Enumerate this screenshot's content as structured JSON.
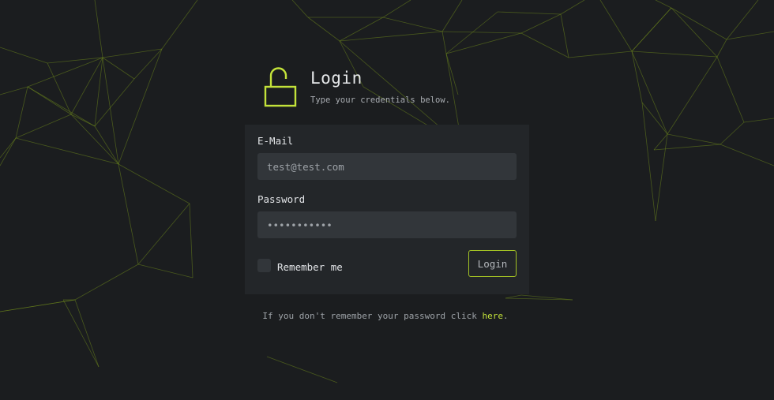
{
  "header": {
    "title": "Login",
    "subtitle": "Type your credentials below.",
    "icon": "unlocked-padlock-icon"
  },
  "form": {
    "email_label": "E-Mail",
    "email_value": "test@test.com",
    "password_label": "Password",
    "password_value": "•••••••••••",
    "remember_label": "Remember me",
    "remember_checked": false,
    "submit_label": "Login"
  },
  "footer": {
    "forgot_text": "If you don't remember your password click",
    "forgot_link": "here",
    "forgot_suffix": "."
  },
  "colors": {
    "background": "#1b1d1f",
    "card": "#232629",
    "input": "#32363a",
    "accent": "#c3e23a",
    "network_lines": "#6f8a1c"
  }
}
